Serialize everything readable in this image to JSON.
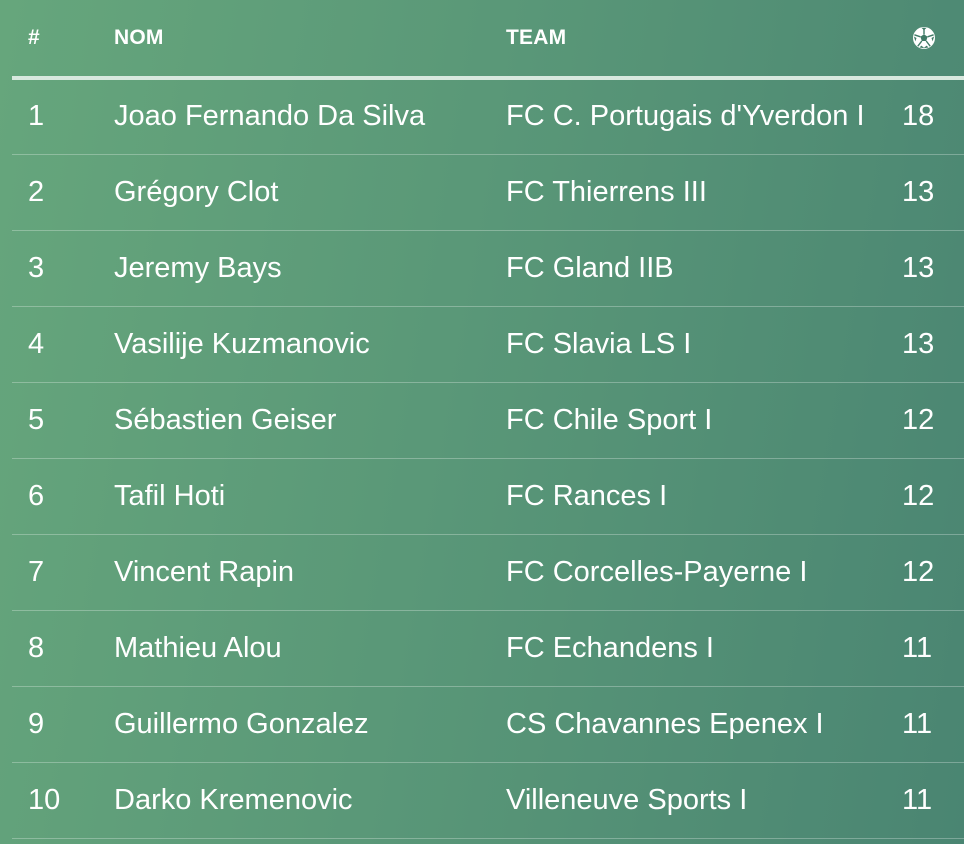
{
  "table": {
    "headers": {
      "rank": "#",
      "name": "NOM",
      "team": "TEAM",
      "goals_icon": "soccer-ball-icon"
    },
    "rows": [
      {
        "rank": "1",
        "name": "Joao Fernando Da Silva",
        "team": "FC C. Portugais d'Yverdon I",
        "goals": "18"
      },
      {
        "rank": "2",
        "name": "Grégory Clot",
        "team": "FC Thierrens III",
        "goals": "13"
      },
      {
        "rank": "3",
        "name": "Jeremy Bays",
        "team": "FC Gland IIB",
        "goals": "13"
      },
      {
        "rank": "4",
        "name": "Vasilije Kuzmanovic",
        "team": "FC Slavia LS I",
        "goals": "13"
      },
      {
        "rank": "5",
        "name": "Sébastien Geiser",
        "team": "FC Chile Sport I",
        "goals": "12"
      },
      {
        "rank": "6",
        "name": "Tafil Hoti",
        "team": "FC Rances I",
        "goals": "12"
      },
      {
        "rank": "7",
        "name": "Vincent Rapin",
        "team": "FC Corcelles-Payerne I",
        "goals": "12"
      },
      {
        "rank": "8",
        "name": "Mathieu Alou",
        "team": "FC Echandens I",
        "goals": "11"
      },
      {
        "rank": "9",
        "name": "Guillermo Gonzalez",
        "team": "CS Chavannes Epenex I",
        "goals": "11"
      },
      {
        "rank": "10",
        "name": "Darko Kremenovic",
        "team": "Villeneuve Sports I",
        "goals": "11"
      }
    ]
  },
  "colors": {
    "background_start": "#66a67c",
    "background_end": "#4a8572",
    "text": "#ffffff",
    "header_rule": "#d8e8de"
  }
}
